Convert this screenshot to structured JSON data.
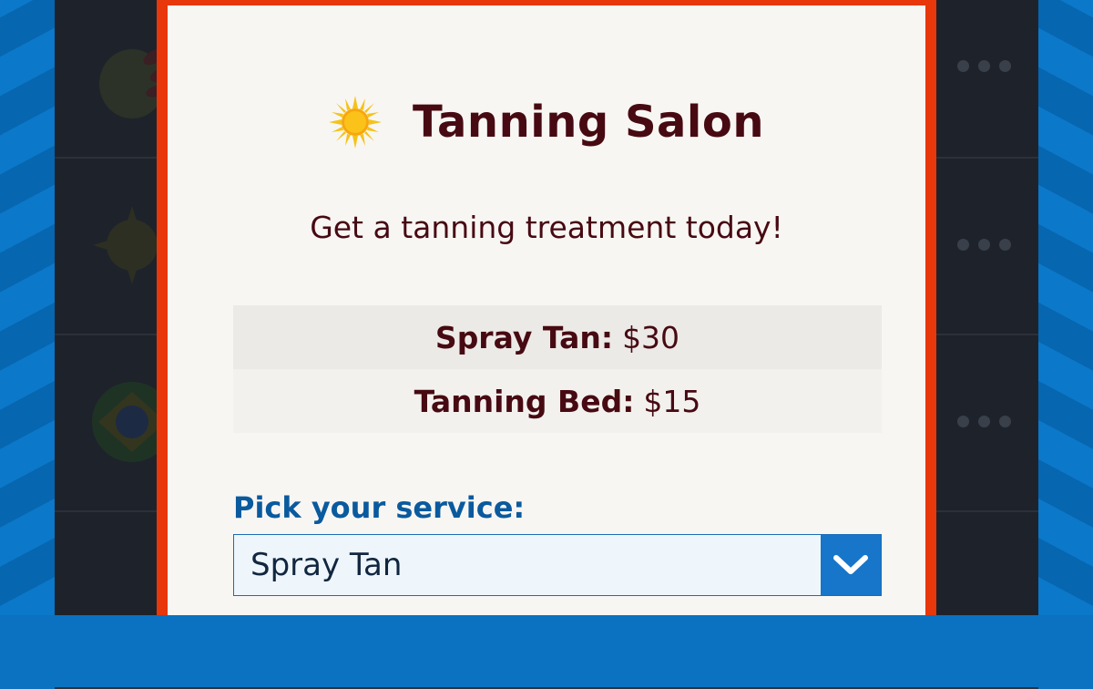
{
  "modal": {
    "title": "Tanning Salon",
    "title_icon": "sun-icon",
    "subtitle": "Get a tanning treatment today!",
    "prices": [
      {
        "label": "Spray Tan:",
        "value": "$30"
      },
      {
        "label": "Tanning Bed:",
        "value": "$15"
      }
    ],
    "service_prompt": "Pick your service:",
    "selected_service": "Spray Tan",
    "dropdown_icon": "chevron-down-icon"
  },
  "colors": {
    "modal_border": "#e8370b",
    "title_text": "#470a12",
    "prompt_text": "#0a5a9e",
    "dropdown_button": "#1776c9"
  }
}
